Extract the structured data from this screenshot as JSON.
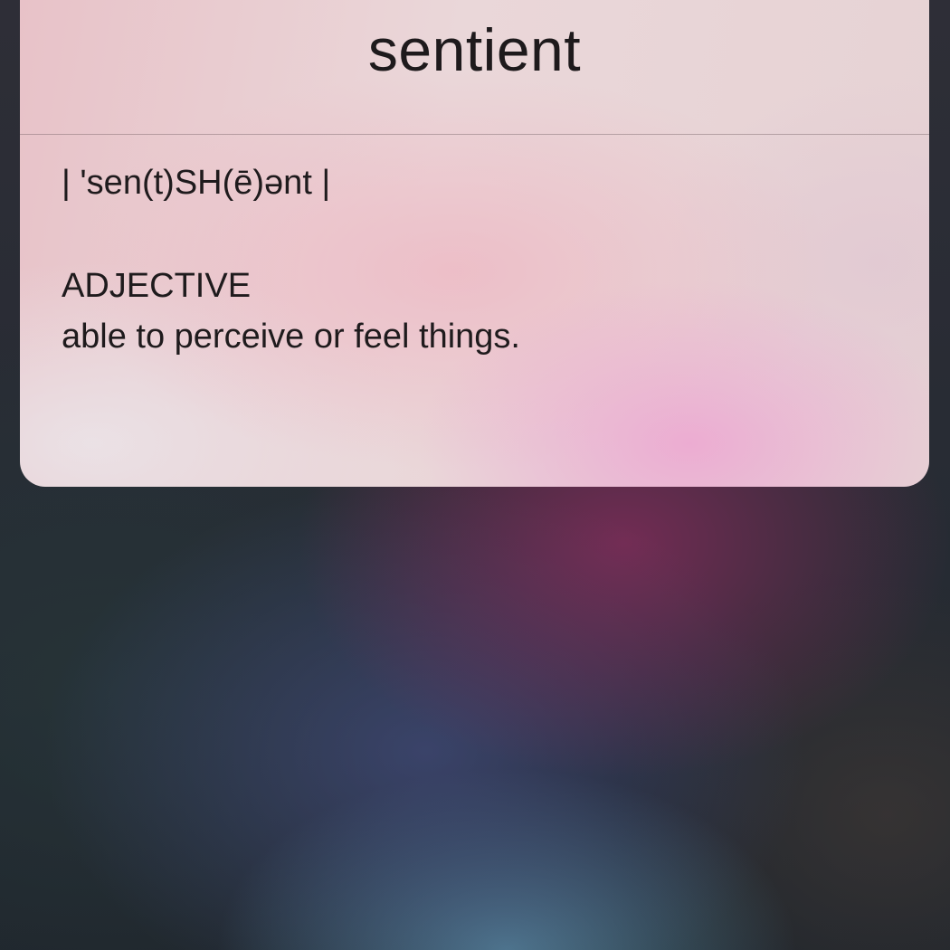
{
  "definition_card": {
    "word": "sentient",
    "pronunciation": "| 'sen(t)SH(ē)ənt |",
    "part_of_speech": "ADJECTIVE",
    "definition": "able to perceive or feel things."
  },
  "colors": {
    "card_text": "#1f1b1d",
    "card_base": "#e9d9dc",
    "background_base": "#262a33",
    "glow_magenta": "#8c2d5f",
    "glow_blue": "#464f87",
    "glow_cyan": "#5f96af"
  }
}
